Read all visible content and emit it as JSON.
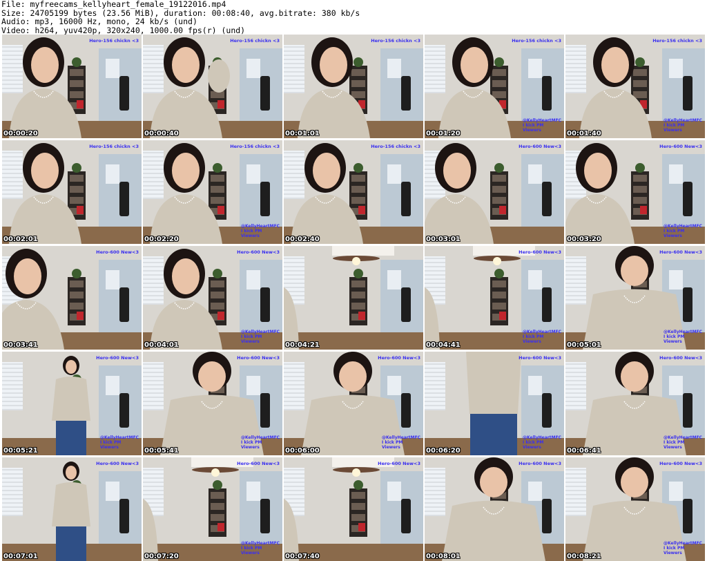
{
  "header": {
    "line1": "File: myfreecams_kellyheart_female_19122016.mp4",
    "line2": "Size: 24705199 bytes (23.56 MiB), duration: 00:08:40, avg.bitrate: 380 kb/s",
    "line3": "Audio: mp3, 16000 Hz, mono, 24 kb/s (und)",
    "line4": "Video: h264, yuv420p, 320x240, 1000.00 fps(r) (und)"
  },
  "frames": [
    {
      "t": "00:00:20",
      "tag": "Hero-156 chickn <3",
      "sub": "",
      "scene": "front"
    },
    {
      "t": "00:00:40",
      "tag": "Hero-156 chickn <3",
      "sub": "",
      "scene": "front-wave"
    },
    {
      "t": "00:01:01",
      "tag": "Hero-156 chickn <3",
      "sub": "",
      "scene": "front-right"
    },
    {
      "t": "00:01:20",
      "tag": "Hero-156 chickn <3",
      "sub": "@KellyHeartMFC I kick PM Viewers",
      "scene": "front-right"
    },
    {
      "t": "00:01:40",
      "tag": "Hero-156 chickn <3",
      "sub": "@KellyHeartMFC I kick PM Viewers",
      "scene": "front-right"
    },
    {
      "t": "00:02:01",
      "tag": "Hero-156 chickn <3",
      "sub": "",
      "scene": "front"
    },
    {
      "t": "00:02:20",
      "tag": "Hero-156 chickn <3",
      "sub": "@KellyHeartMFC I kick PM Viewers",
      "scene": "front"
    },
    {
      "t": "00:02:40",
      "tag": "Hero-156 chickn <3",
      "sub": "",
      "scene": "front"
    },
    {
      "t": "00:03:01",
      "tag": "Hero-600 New<3",
      "sub": "",
      "scene": "side"
    },
    {
      "t": "00:03:20",
      "tag": "Hero-600 New<3",
      "sub": "@KellyHeartMFC I kick PM Viewers",
      "scene": "side"
    },
    {
      "t": "00:03:41",
      "tag": "Hero-600 New<3",
      "sub": "",
      "scene": "side-left"
    },
    {
      "t": "00:04:01",
      "tag": "Hero-600 New<3",
      "sub": "@KellyHeartMFC I kick PM Viewers",
      "scene": "front"
    },
    {
      "t": "00:04:21",
      "tag": "",
      "sub": "",
      "scene": "room"
    },
    {
      "t": "00:04:41",
      "tag": "Hero-600 New<3",
      "sub": "@KellyHeartMFC I kick PM Viewers",
      "scene": "room"
    },
    {
      "t": "00:05:01",
      "tag": "Hero-600 New<3",
      "sub": "@KellyHeartMFC I kick PM Viewers",
      "scene": "lean"
    },
    {
      "t": "00:05:21",
      "tag": "Hero-600 New<3",
      "sub": "@KellyHeartMFC I kick PM Viewers",
      "scene": "standing"
    },
    {
      "t": "00:05:41",
      "tag": "Hero-600 New<3",
      "sub": "@KellyHeartMFC I kick PM Viewers",
      "scene": "lean"
    },
    {
      "t": "00:06:00",
      "tag": "Hero-600 New<3",
      "sub": "@KellyHeartMFC I kick PM Viewers",
      "scene": "lean"
    },
    {
      "t": "00:06:20",
      "tag": "Hero-600 New<3",
      "sub": "@KellyHeartMFC I kick PM Viewers",
      "scene": "back"
    },
    {
      "t": "00:06:41",
      "tag": "Hero-600 New<3",
      "sub": "@KellyHeartMFC I kick PM Viewers",
      "scene": "lean"
    },
    {
      "t": "00:07:01",
      "tag": "Hero-600 New<3",
      "sub": "",
      "scene": "standing"
    },
    {
      "t": "00:07:20",
      "tag": "Hero-600 New<3",
      "sub": "@KellyHeartMFC I kick PM Viewers",
      "scene": "room"
    },
    {
      "t": "00:07:40",
      "tag": "Hero-600 New<3",
      "sub": "",
      "scene": "room"
    },
    {
      "t": "00:08:01",
      "tag": "Hero-600 New<3",
      "sub": "",
      "scene": "lean"
    },
    {
      "t": "00:08:21",
      "tag": "Hero-600 New<3",
      "sub": "@KellyHeartMFC I kick PM Viewers",
      "scene": "lean"
    }
  ]
}
